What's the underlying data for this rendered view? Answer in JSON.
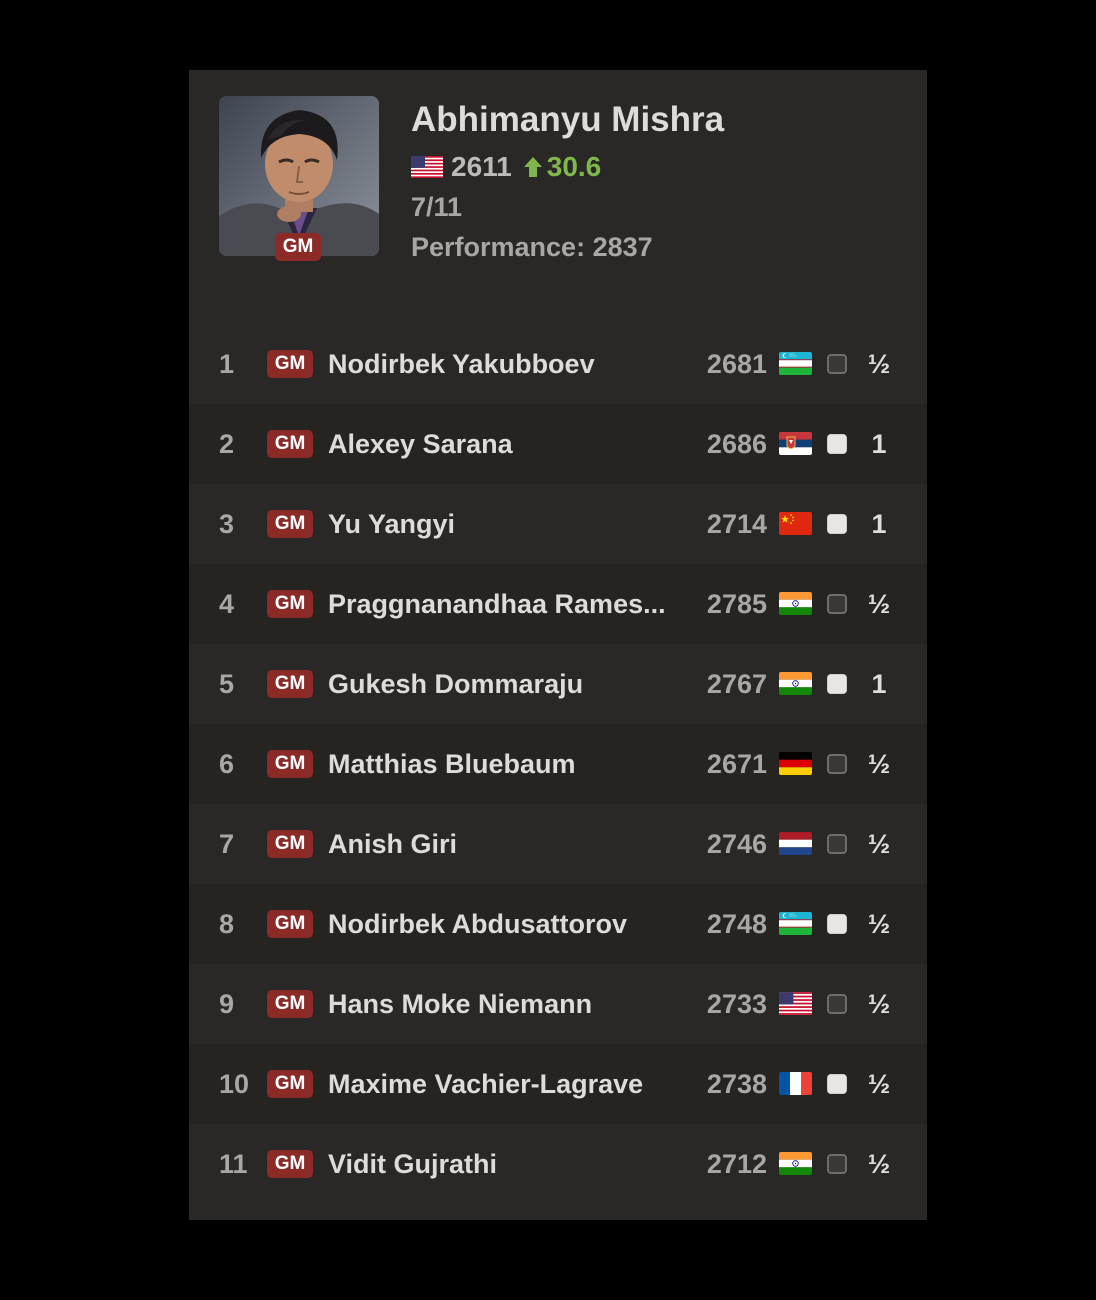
{
  "player": {
    "name": "Abhimanyu Mishra",
    "title": "GM",
    "country_flag": "us-flag-icon",
    "rating": "2611",
    "rating_change": "30.6",
    "rating_change_color": "#81b64c",
    "score": "7/11",
    "performance": "Performance: 2837"
  },
  "colors": {
    "card_bg": "#2a2826",
    "row_alt_bg": "#262421",
    "title_badge_bg": "#8c2a27"
  },
  "opponents": [
    {
      "round": "1",
      "title": "GM",
      "name": "Nodirbek Yakubboev",
      "rating": "2681",
      "flag": "uzbekistan-flag-icon",
      "color": "black",
      "result": "½"
    },
    {
      "round": "2",
      "title": "GM",
      "name": "Alexey Sarana",
      "rating": "2686",
      "flag": "serbia-flag-icon",
      "color": "white",
      "result": "1"
    },
    {
      "round": "3",
      "title": "GM",
      "name": "Yu Yangyi",
      "rating": "2714",
      "flag": "china-flag-icon",
      "color": "white",
      "result": "1"
    },
    {
      "round": "4",
      "title": "GM",
      "name": "Praggnanandhaa Rames...",
      "rating": "2785",
      "flag": "india-flag-icon",
      "color": "black",
      "result": "½"
    },
    {
      "round": "5",
      "title": "GM",
      "name": "Gukesh Dommaraju",
      "rating": "2767",
      "flag": "india-flag-icon",
      "color": "white",
      "result": "1"
    },
    {
      "round": "6",
      "title": "GM",
      "name": "Matthias Bluebaum",
      "rating": "2671",
      "flag": "germany-flag-icon",
      "color": "black",
      "result": "½"
    },
    {
      "round": "7",
      "title": "GM",
      "name": "Anish Giri",
      "rating": "2746",
      "flag": "netherlands-flag-icon",
      "color": "black",
      "result": "½"
    },
    {
      "round": "8",
      "title": "GM",
      "name": "Nodirbek Abdusattorov",
      "rating": "2748",
      "flag": "uzbekistan-flag-icon",
      "color": "white",
      "result": "½"
    },
    {
      "round": "9",
      "title": "GM",
      "name": "Hans Moke Niemann",
      "rating": "2733",
      "flag": "us-flag-icon",
      "color": "black",
      "result": "½"
    },
    {
      "round": "10",
      "title": "GM",
      "name": "Maxime Vachier-Lagrave",
      "rating": "2738",
      "flag": "france-flag-icon",
      "color": "white",
      "result": "½"
    },
    {
      "round": "11",
      "title": "GM",
      "name": "Vidit Gujrathi",
      "rating": "2712",
      "flag": "india-flag-icon",
      "color": "black",
      "result": "½"
    }
  ]
}
